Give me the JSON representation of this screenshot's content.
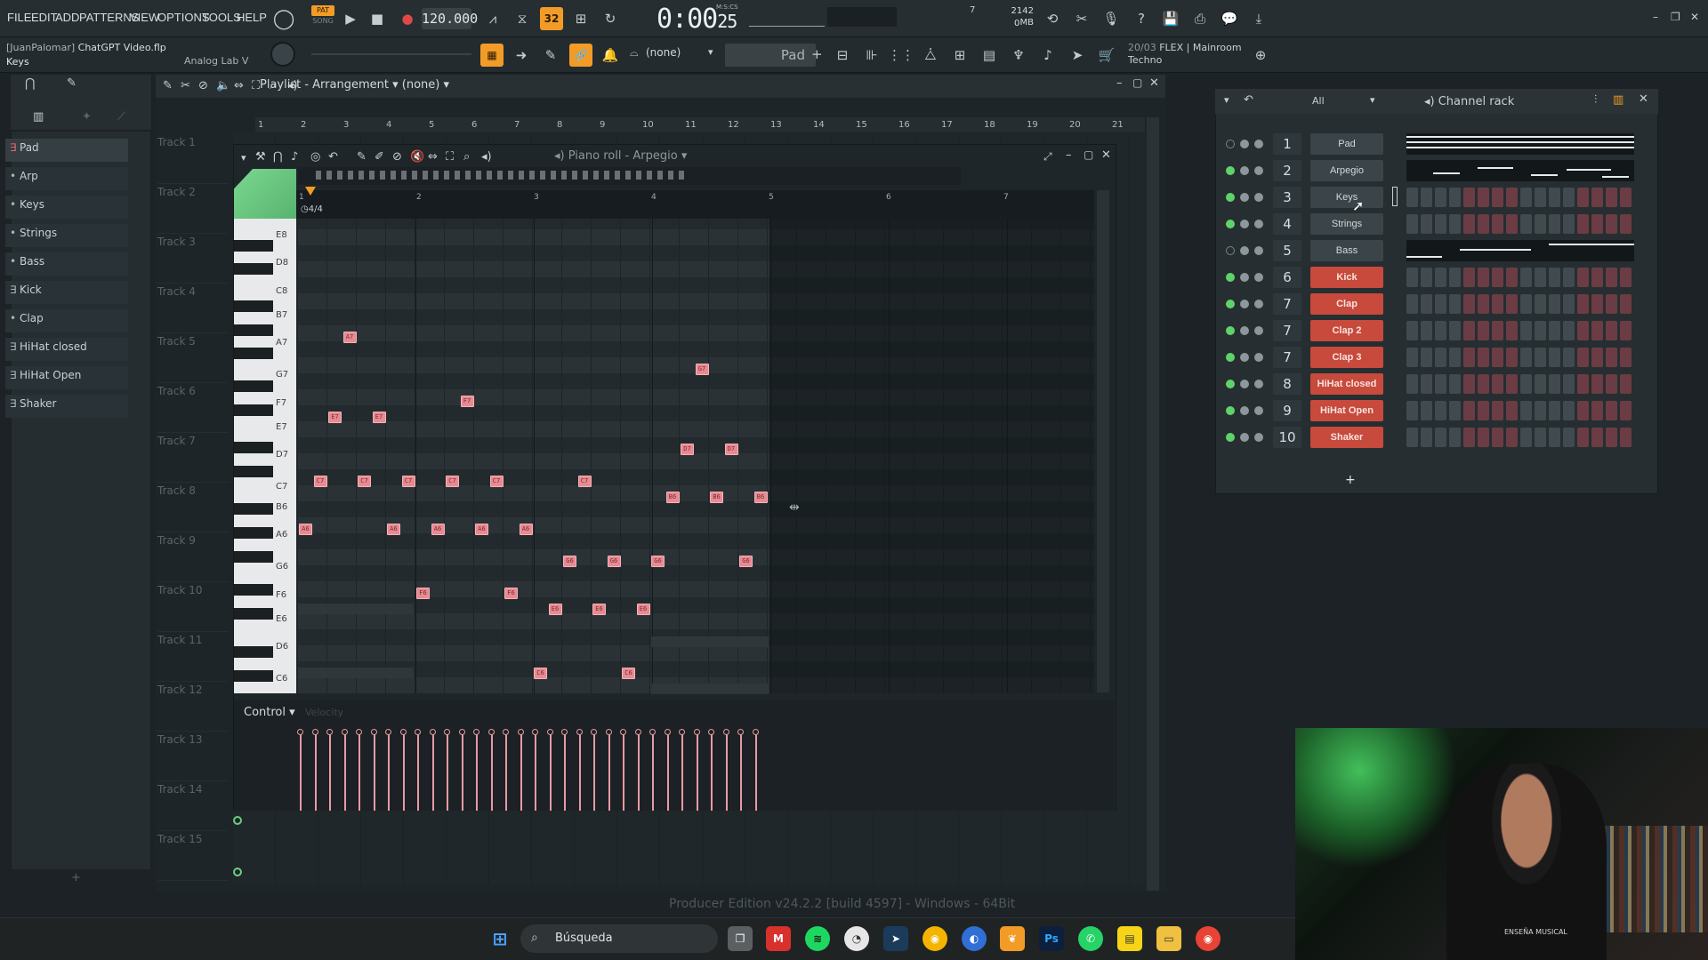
{
  "menu": [
    "FILE",
    "EDIT",
    "ADD",
    "PATTERNS",
    "VIEW",
    "OPTIONS",
    "TOOLS",
    "HELP"
  ],
  "transport": {
    "pat_label": "PAT",
    "song_label": "SONG",
    "tempo": "120.000",
    "time": "0:00",
    "time_sub": "25",
    "time_format": "M:S:CS",
    "step_label": "32",
    "memory_value": "2142 MB",
    "cpu_value": "7",
    "memory_zero": "0"
  },
  "toolbar2": {
    "user": "[JuanPalomar]",
    "project": "ChatGPT Video.flp",
    "hint": "Keys",
    "plugin": "Analog Lab V",
    "snap": "(none)",
    "pattern": "Pad",
    "news_date": "20/03",
    "news_line1": "FLEX | Mainroom",
    "news_line2": "Techno"
  },
  "browser": {
    "items": [
      {
        "label": "Pad",
        "active": true
      },
      {
        "label": "Arp",
        "active": false
      },
      {
        "label": "Keys",
        "active": false
      },
      {
        "label": "Strings",
        "active": false
      },
      {
        "label": "Bass",
        "active": false
      },
      {
        "label": "Kick",
        "active": false
      },
      {
        "label": "Clap",
        "active": false
      },
      {
        "label": "HiHat closed",
        "active": false
      },
      {
        "label": "HiHat Open",
        "active": false
      },
      {
        "label": "Shaker",
        "active": false
      }
    ]
  },
  "playlist": {
    "title": "Playlist - Arrangement",
    "selector": "(none)",
    "bar_numbers": [
      "1",
      "2",
      "3",
      "4",
      "5",
      "6",
      "7",
      "8",
      "9",
      "10",
      "11",
      "12",
      "13",
      "14",
      "15",
      "16",
      "17",
      "18",
      "19",
      "20",
      "21"
    ],
    "tracks": [
      "Track 1",
      "Track 2",
      "Track 3",
      "Track 4",
      "Track 5",
      "Track 6",
      "Track 7",
      "Track 8",
      "Track 9",
      "Track 10",
      "Track 11",
      "Track 12",
      "Track 13",
      "Track 14",
      "Track 15"
    ]
  },
  "piano_roll": {
    "title": "Piano roll - Arpegio",
    "time_signature": "4/4",
    "bar_numbers": [
      "1",
      "2",
      "3",
      "4",
      "5",
      "6",
      "7"
    ],
    "key_labels": [
      "E8",
      "D8",
      "C8",
      "B7",
      "A7",
      "G7",
      "F7",
      "E7",
      "D7",
      "C7",
      "B6",
      "A6",
      "G6",
      "F6",
      "E6",
      "D6",
      "C6"
    ],
    "notes": [
      {
        "pitch": "A6",
        "step": 0
      },
      {
        "pitch": "C7",
        "step": 1
      },
      {
        "pitch": "E7",
        "step": 2
      },
      {
        "pitch": "A7",
        "step": 3
      },
      {
        "pitch": "C7",
        "step": 4
      },
      {
        "pitch": "E7",
        "step": 5
      },
      {
        "pitch": "A6",
        "step": 6
      },
      {
        "pitch": "C7",
        "step": 7
      },
      {
        "pitch": "F6",
        "step": 8
      },
      {
        "pitch": "A6",
        "step": 9
      },
      {
        "pitch": "C7",
        "step": 10
      },
      {
        "pitch": "F7",
        "step": 11
      },
      {
        "pitch": "A6",
        "step": 12
      },
      {
        "pitch": "C7",
        "step": 13
      },
      {
        "pitch": "F6",
        "step": 14
      },
      {
        "pitch": "A6",
        "step": 15
      },
      {
        "pitch": "C6",
        "step": 16
      },
      {
        "pitch": "E6",
        "step": 17
      },
      {
        "pitch": "G6",
        "step": 18
      },
      {
        "pitch": "C7",
        "step": 19
      },
      {
        "pitch": "E6",
        "step": 20
      },
      {
        "pitch": "G6",
        "step": 21
      },
      {
        "pitch": "C6",
        "step": 22
      },
      {
        "pitch": "E6",
        "step": 23
      },
      {
        "pitch": "G6",
        "step": 24
      },
      {
        "pitch": "B6",
        "step": 25
      },
      {
        "pitch": "D7",
        "step": 26
      },
      {
        "pitch": "G7",
        "step": 27
      },
      {
        "pitch": "B6",
        "step": 28
      },
      {
        "pitch": "D7",
        "step": 29
      },
      {
        "pitch": "G6",
        "step": 30
      },
      {
        "pitch": "B6",
        "step": 31
      }
    ],
    "control_label": "Control",
    "velocity_label": "Velocity"
  },
  "channel_rack": {
    "title": "Channel rack",
    "filter": "All",
    "channels": [
      {
        "num": "1",
        "name": "Pad",
        "style": "grey",
        "led": "off",
        "preview": true
      },
      {
        "num": "2",
        "name": "Arpegio",
        "style": "grey",
        "led": "on",
        "preview": true
      },
      {
        "num": "3",
        "name": "Keys",
        "style": "grey",
        "led": "on",
        "preview": false
      },
      {
        "num": "4",
        "name": "Strings",
        "style": "grey",
        "led": "on",
        "preview": false
      },
      {
        "num": "5",
        "name": "Bass",
        "style": "grey",
        "led": "off",
        "preview": true
      },
      {
        "num": "6",
        "name": "Kick",
        "style": "red",
        "led": "on",
        "preview": false
      },
      {
        "num": "7",
        "name": "Clap",
        "style": "red",
        "led": "on",
        "preview": false
      },
      {
        "num": "7",
        "name": "Clap 2",
        "style": "red",
        "led": "on",
        "preview": false
      },
      {
        "num": "7",
        "name": "Clap 3",
        "style": "red",
        "led": "on",
        "preview": false
      },
      {
        "num": "8",
        "name": "HiHat closed",
        "style": "red",
        "led": "on",
        "preview": false
      },
      {
        "num": "9",
        "name": "HiHat Open",
        "style": "red",
        "led": "on",
        "preview": false
      },
      {
        "num": "10",
        "name": "Shaker",
        "style": "red",
        "led": "on",
        "preview": false
      }
    ],
    "add_label": "+"
  },
  "status": {
    "edition": "Producer Edition v24.2.2 [build 4597] - Windows - 64Bit"
  },
  "taskbar": {
    "search_placeholder": "Búsqueda",
    "photoshop": "Ps"
  },
  "webcam": {
    "shirt_text": "ENSEÑA MUSICAL"
  },
  "colors": {
    "accent_orange": "#f29c27",
    "note_pink": "#e88a92",
    "channel_red": "#c74a3c",
    "led_green": "#5fd36a"
  }
}
